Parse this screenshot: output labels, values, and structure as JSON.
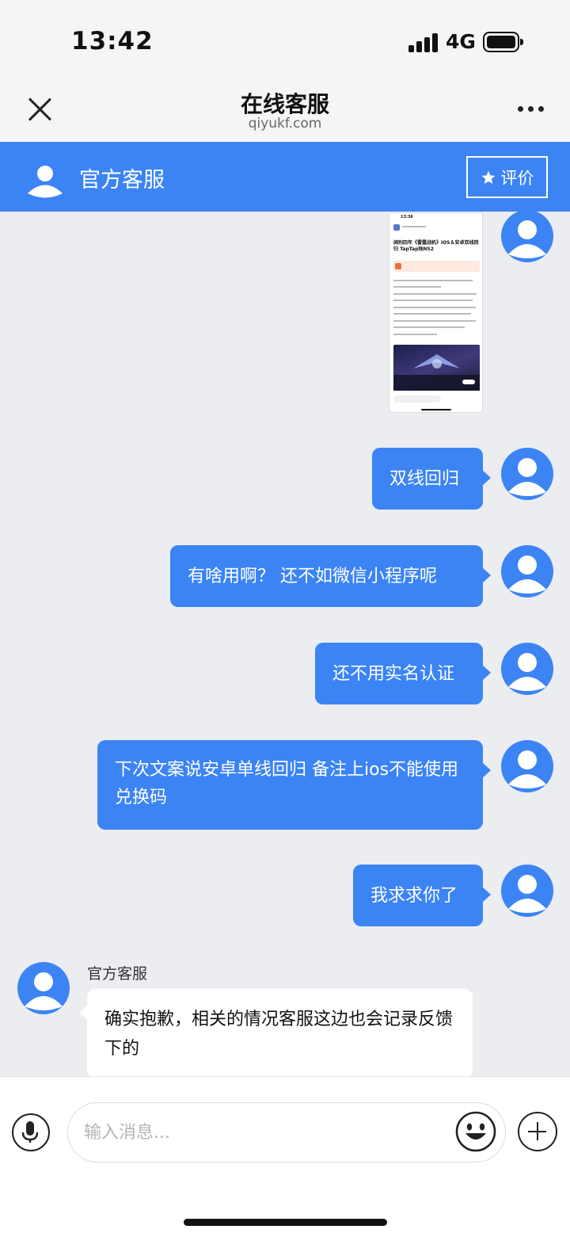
{
  "status_bar": {
    "time": "13:42",
    "network": "4G"
  },
  "nav": {
    "title": "在线客服",
    "subtitle": "qiyukf.com"
  },
  "agent_bar": {
    "name": "官方客服",
    "rate_label": "评价"
  },
  "shared_image": {
    "time": "13:36",
    "title": "阔别四年《雷霆战机》iOS＆安卓双线回归 TapTap独NS2"
  },
  "messages": [
    {
      "text": "双线回归"
    },
    {
      "text": "有啥用啊？ 还不如微信小程序呢"
    },
    {
      "text": "还不用实名认证"
    },
    {
      "text": "下次文案说安卓单线回归 备注上ios不能使用兑换码"
    },
    {
      "text": "我求求你了"
    }
  ],
  "reply": {
    "sender": "官方客服",
    "text": "确实抱歉，相关的情况客服这边也会记录反馈下的"
  },
  "input": {
    "placeholder": "输入消息..."
  },
  "colors": {
    "accent": "#3c84f4",
    "background": "#ebedf1"
  }
}
